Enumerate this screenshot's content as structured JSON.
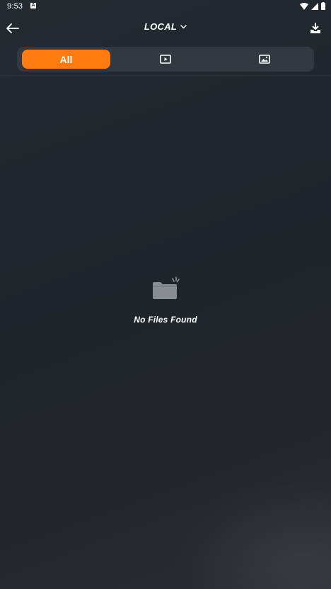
{
  "status_bar": {
    "time": "9:53",
    "notification_icon": "A",
    "icons": [
      "wifi-icon",
      "signal-icon",
      "battery-icon"
    ]
  },
  "header": {
    "title": "LOCAL",
    "back_icon": "arrow-left-icon",
    "dropdown_icon": "chevron-down-icon",
    "download_icon": "download-icon"
  },
  "tabs": [
    {
      "label": "All",
      "selected": true
    },
    {
      "label": "",
      "icon": "video-icon",
      "selected": false
    },
    {
      "label": "",
      "icon": "image-icon",
      "selected": false
    }
  ],
  "empty_state": {
    "icon": "empty-folder-icon",
    "message": "No Files Found"
  },
  "colors": {
    "accent": "#ff7a0f",
    "background": "#1f252c",
    "tab_bar": "#333841"
  }
}
